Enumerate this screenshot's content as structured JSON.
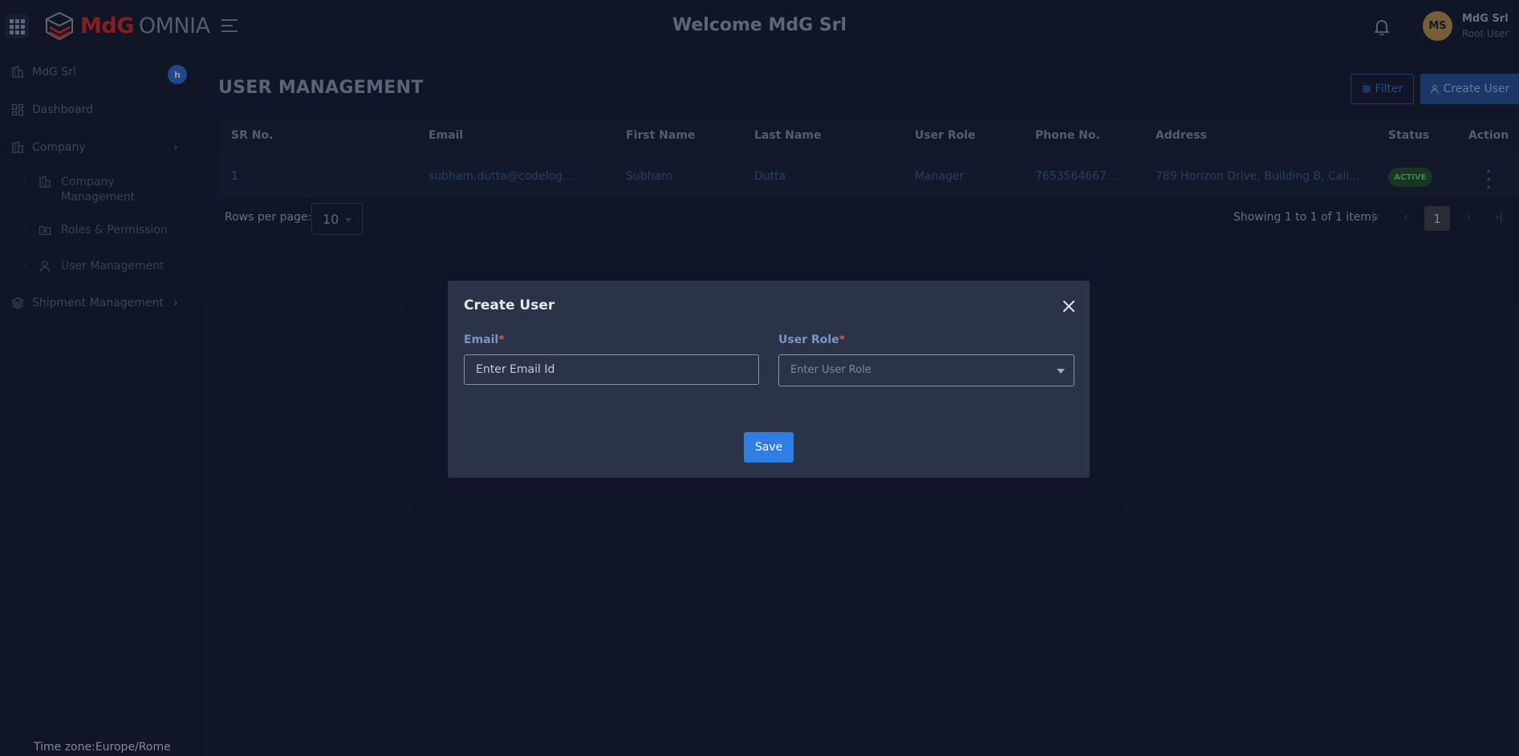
{
  "header": {
    "brand_primary": "MdG",
    "brand_secondary": "OMNIA",
    "welcome": "Welcome MdG Srl",
    "avatar_initials": "MS",
    "user_name": "MdG Srl",
    "user_role": "Root User"
  },
  "sidebar": {
    "company_name": "MdG Srl",
    "company_badge": "h",
    "items": [
      {
        "label": "Dashboard",
        "icon": "dashboard-icon"
      },
      {
        "label": "Company",
        "icon": "building-icon"
      },
      {
        "label": "Shipment Management",
        "icon": "layers-icon"
      }
    ],
    "sub_items": [
      {
        "label": "Company Management",
        "icon": "building-icon"
      },
      {
        "label": "Roles & Permission",
        "icon": "folder-user-icon"
      },
      {
        "label": "User Management",
        "icon": "user-icon"
      }
    ],
    "timezone": "Time zone:Europe/Rome"
  },
  "main": {
    "title": "USER MANAGEMENT",
    "filter_label": "Filter",
    "create_label": "Create User",
    "columns": [
      "SR No.",
      "Email",
      "First Name",
      "Last Name",
      "User Role",
      "Phone No.",
      "Address",
      "Status",
      "Action"
    ],
    "rows": [
      {
        "sr": "1",
        "email": "subham.dutta@codelog...",
        "first_name": "Subham",
        "last_name": "Dutta",
        "role": "Manager",
        "phone": "7653564667...",
        "address": "789 Horizon Drive, Building B, Cali...",
        "status": "ACTIVE"
      }
    ],
    "rows_per_page_label": "Rows per page:",
    "rows_per_page": "10",
    "showing": "Showing 1 to 1 of 1 items",
    "current_page": "1"
  },
  "modal": {
    "title": "Create User",
    "email_label": "Email",
    "email_placeholder": "Enter Email Id",
    "role_label": "User Role",
    "role_placeholder": "Enter User Role",
    "required_mark": "*",
    "save_label": "Save"
  },
  "colors": {
    "background": "#151d30",
    "accent": "#2f7ee3",
    "brand": "#c72a2a",
    "active": "#58c26f"
  }
}
